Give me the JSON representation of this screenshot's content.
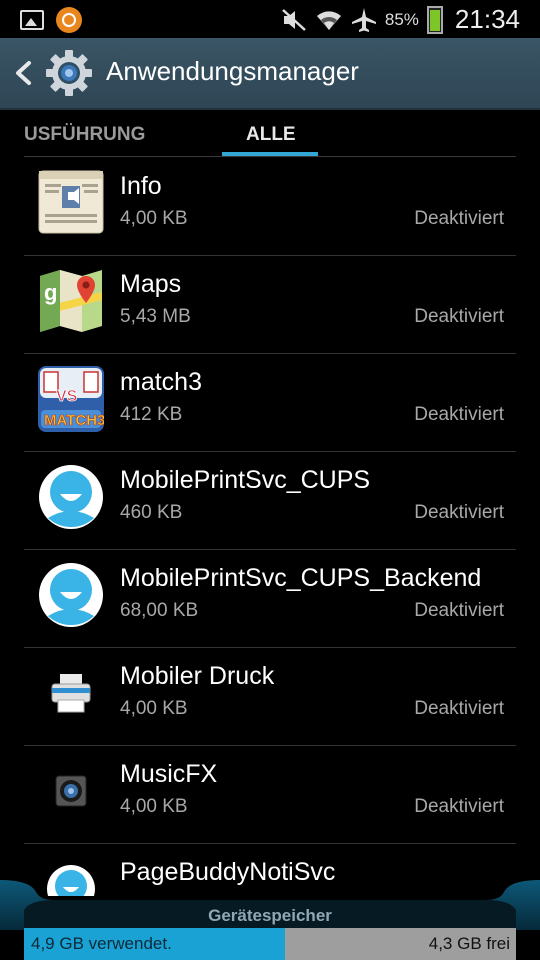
{
  "statusbar": {
    "battery_percent": "85%",
    "battery_level": 0.85,
    "clock": "21:34",
    "icons": [
      "gallery-icon",
      "app-notification-icon",
      "mute-icon",
      "wifi-icon",
      "airplane-mode-icon",
      "battery-icon"
    ]
  },
  "actionbar": {
    "title": "Anwendungsmanager",
    "icons": [
      "back-arrow-icon",
      "settings-gear-icon"
    ]
  },
  "tabs": [
    {
      "label": "USFÜHRUNG",
      "selected": false
    },
    {
      "label": "ALLE",
      "selected": true
    }
  ],
  "apps": [
    {
      "name": "Info",
      "size": "4,00 KB",
      "status": "Deaktiviert",
      "icon": "news-info-icon"
    },
    {
      "name": "Maps",
      "size": "5,43 MB",
      "status": "Deaktiviert",
      "icon": "maps-icon"
    },
    {
      "name": "match3",
      "size": "412 KB",
      "status": "Deaktiviert",
      "icon": "match3-game-icon"
    },
    {
      "name": "MobilePrintSvc_CUPS",
      "size": "460 KB",
      "status": "Deaktiviert",
      "icon": "smiley-face-icon"
    },
    {
      "name": "MobilePrintSvc_CUPS_Backend",
      "size": "68,00 KB",
      "status": "Deaktiviert",
      "icon": "smiley-face-icon"
    },
    {
      "name": "Mobiler Druck",
      "size": "4,00 KB",
      "status": "Deaktiviert",
      "icon": "printer-icon"
    },
    {
      "name": "MusicFX",
      "size": "4,00 KB",
      "status": "Deaktiviert",
      "icon": "speaker-icon"
    },
    {
      "name": "PageBuddyNotiSvc",
      "size": "",
      "status": "",
      "icon": "smiley-face-icon"
    }
  ],
  "storage": {
    "label": "Gerätespeicher",
    "used": "4,9 GB verwendet.",
    "free": "4,3 GB frei",
    "used_fraction": 0.53,
    "used_color": "#1aa2d4",
    "free_color": "#9e9e9e"
  }
}
